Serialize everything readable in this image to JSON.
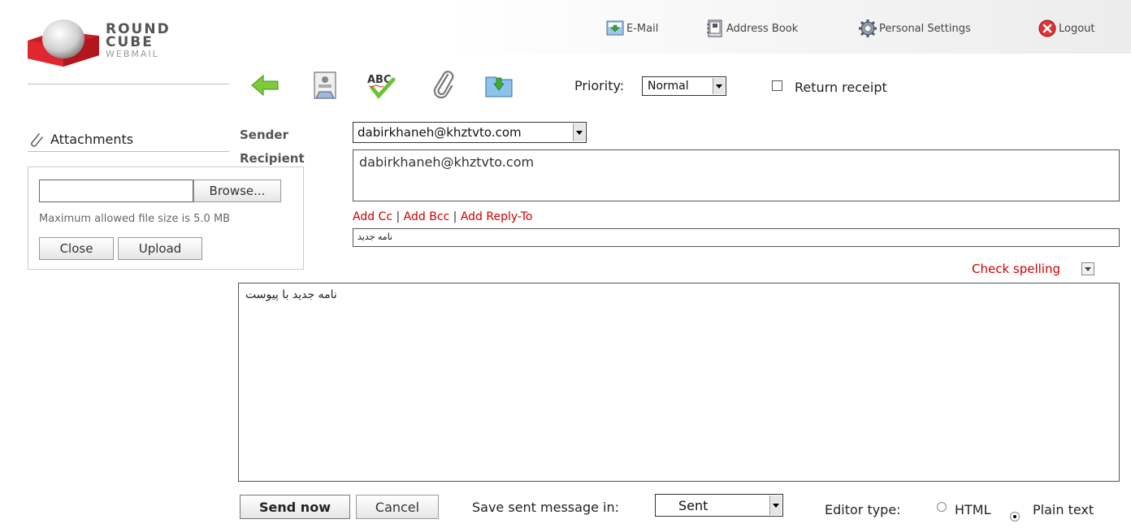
{
  "logo": {
    "line1": "ROUND",
    "line2": "CUBE",
    "line3": "WEBMAIL"
  },
  "topnav": {
    "email": "E-Mail",
    "address_book": "Address Book",
    "personal_settings": "Personal Settings",
    "logout": "Logout"
  },
  "toolbar": {
    "icons": [
      "back-arrow-icon",
      "address-card-icon",
      "spellcheck-abc-icon",
      "paperclip-icon",
      "save-draft-icon"
    ],
    "priority_label": "Priority:",
    "priority_value": "Normal",
    "return_receipt_label": "Return receipt"
  },
  "attachments": {
    "title": "Attachments",
    "browse_label": "Browse...",
    "file_value": "",
    "max_size_note": "Maximum allowed file size is 5.0 MB",
    "close_label": "Close",
    "upload_label": "Upload"
  },
  "compose": {
    "sender_label": "Sender",
    "sender_value": "dabirkhaneh@khztvto.com",
    "recipient_label": "Recipient",
    "recipient_value": "dabirkhaneh@khztvto.com",
    "add_cc": "Add Cc",
    "add_bcc": "Add Bcc",
    "add_reply_to": "Add Reply-To",
    "separator": "|",
    "subject_value": "نامه جدید",
    "check_spelling": "Check spelling",
    "body_value": "نامه جدید با پیوست"
  },
  "footer": {
    "send_now": "Send now",
    "cancel": "Cancel",
    "save_sent_label": "Save sent message in:",
    "save_sent_value": "Sent",
    "editor_type_label": "Editor type:",
    "editor_html": "HTML",
    "editor_plain": "Plain text",
    "editor_selected": "Plain text"
  },
  "colors": {
    "link_red": "#cc0000",
    "logo_red": "#d4202a"
  }
}
